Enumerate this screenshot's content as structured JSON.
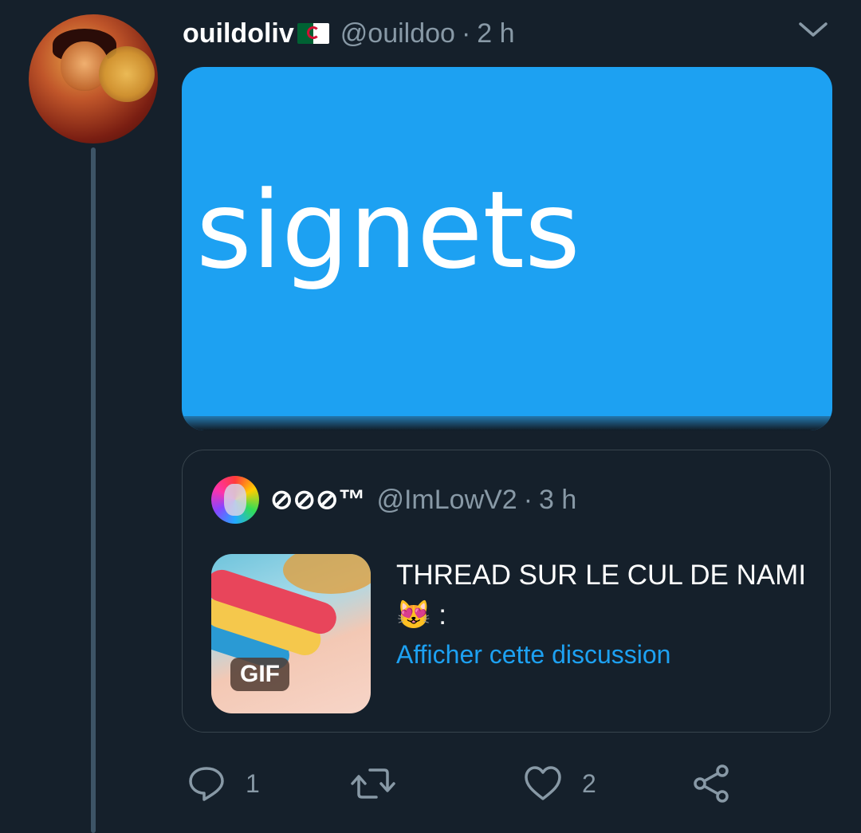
{
  "tweet": {
    "display_name": "ouildoliv",
    "flag_icon": "algeria-flag-icon",
    "handle": "@ouildoo",
    "separator": "·",
    "time": "2 h",
    "media_text": "signets",
    "media_color": "#1da1f2"
  },
  "quoted_tweet": {
    "display_name": "⊘⊘⊘™",
    "handle": "@ImLowV2",
    "separator": "·",
    "time": "3 h",
    "thumbnail_badge": "GIF",
    "text": "THREAD SUR LE CUL DE NAMI 😻 :",
    "link": "Afficher cette discussion",
    "link_color": "#1da1f2"
  },
  "actions": {
    "reply_count": "1",
    "retweet_count": "",
    "like_count": "2",
    "icons": [
      "reply-icon",
      "retweet-icon",
      "like-icon",
      "share-icon"
    ]
  },
  "colors": {
    "background": "#15202b",
    "secondary_text": "#8899a6",
    "border": "#38444d"
  }
}
